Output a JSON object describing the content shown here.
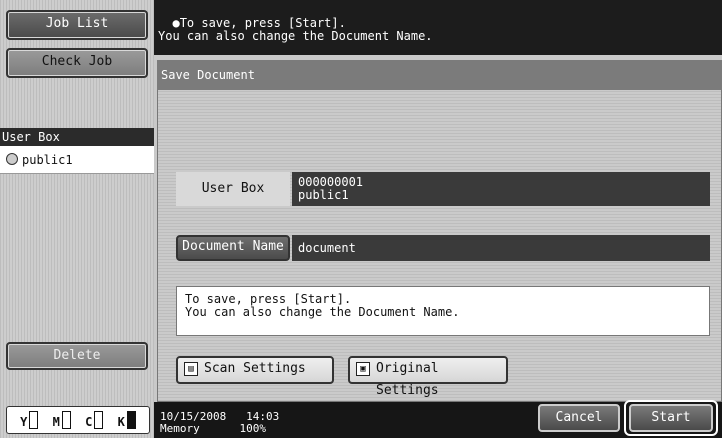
{
  "sidebar": {
    "job_list": "Job List",
    "check_job": "Check Job",
    "user_box_header": "User Box",
    "user_box_item": "public1",
    "delete": "Delete",
    "toner": [
      "Y",
      "M",
      "C",
      "K"
    ]
  },
  "top_message": "To save, press [Start].\nYou can also change the Document Name.",
  "dialog": {
    "title": "Save Document",
    "user_box_label": "User Box",
    "user_box_value": "000000001\npublic1",
    "document_name_label": "Document Name",
    "document_name_value": "document",
    "message": "To save, press [Start].\nYou can also change the Document Name.",
    "scan_settings": "Scan Settings",
    "original_settings": "Original Settings"
  },
  "status": {
    "datetime_memory": "10/15/2008   14:03\nMemory      100%"
  },
  "actions": {
    "cancel": "Cancel",
    "start": "Start"
  }
}
